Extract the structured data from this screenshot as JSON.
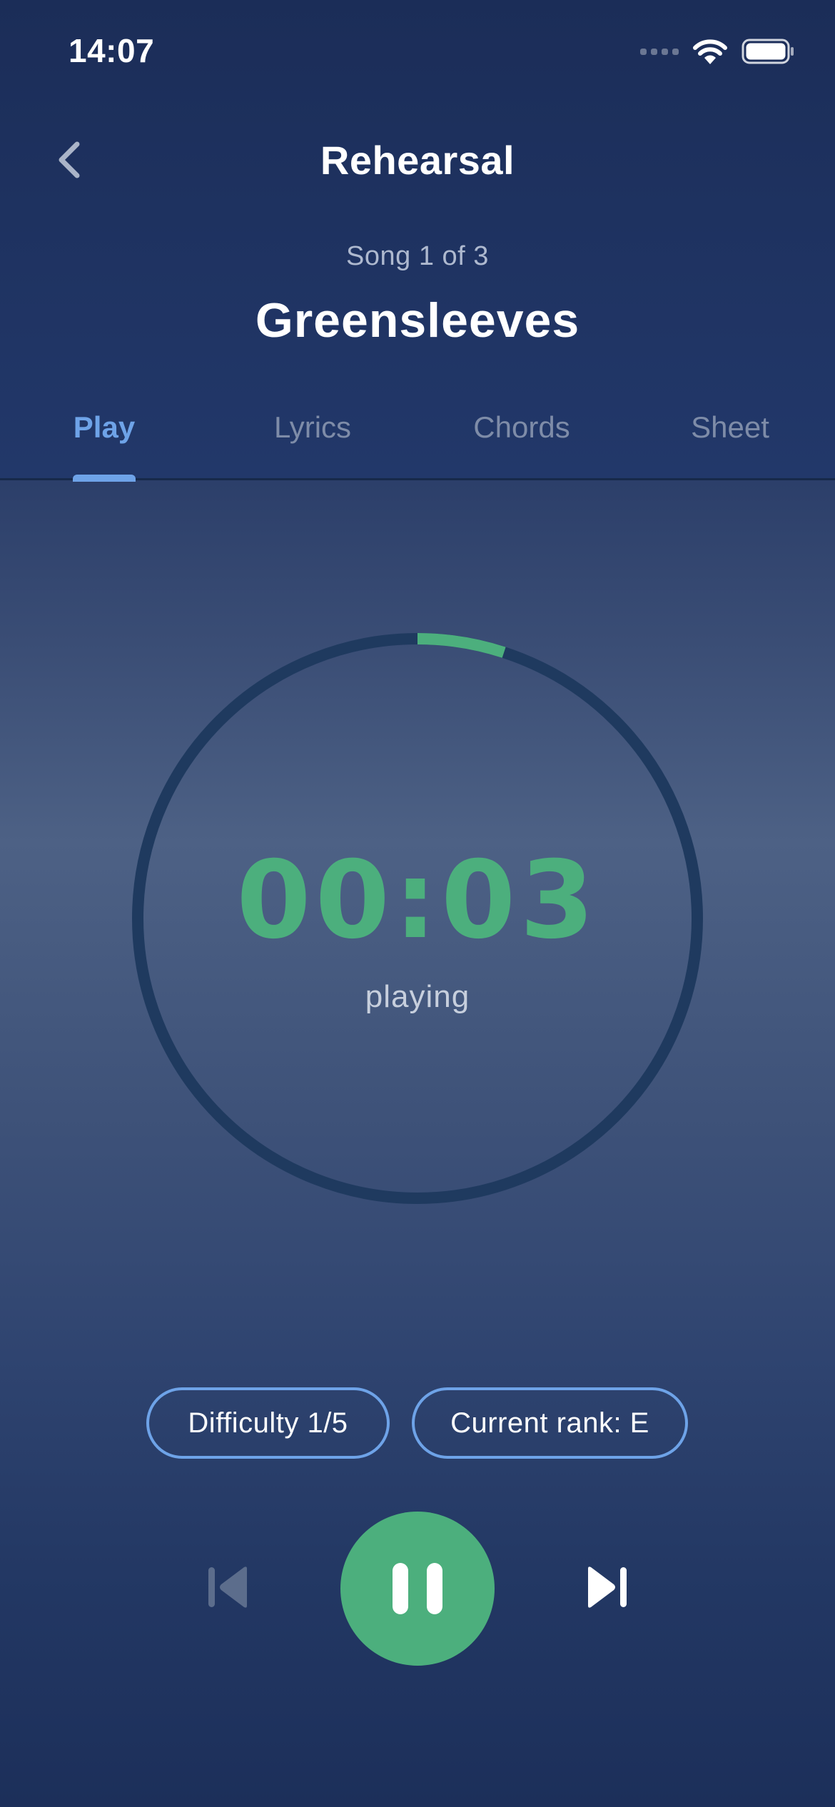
{
  "status_bar": {
    "time": "14:07",
    "icons": [
      "cellular-signal-icon",
      "wifi-icon",
      "battery-icon"
    ]
  },
  "nav": {
    "back_icon": "chevron-left-icon",
    "title": "Rehearsal"
  },
  "song": {
    "count_label": "Song 1 of 3",
    "title": "Greensleeves"
  },
  "tabs": [
    {
      "label": "Play",
      "active": true
    },
    {
      "label": "Lyrics",
      "active": false
    },
    {
      "label": "Chords",
      "active": false
    },
    {
      "label": "Sheet",
      "active": false
    }
  ],
  "timer": {
    "time": "00:03",
    "state": "playing",
    "progress_fraction": 0.05
  },
  "pills": {
    "difficulty": "Difficulty 1/5",
    "rank": "Current rank: E"
  },
  "controls": {
    "previous_icon": "skip-previous-icon",
    "previous_enabled": false,
    "play_pause_icon": "pause-icon",
    "next_icon": "skip-next-icon",
    "next_enabled": true
  },
  "colors": {
    "background": "#1c2f59",
    "accent_blue": "#6ea3e8",
    "accent_green": "#4caf7d",
    "ring_track": "#1f3a5f",
    "muted_text": "#7e8ca8"
  }
}
